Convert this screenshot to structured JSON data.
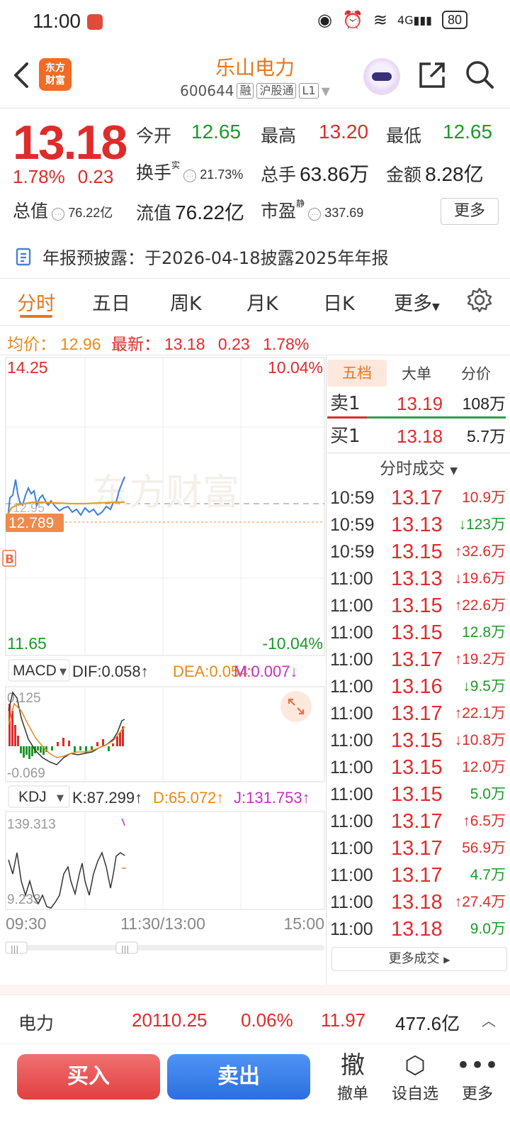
{
  "status_bar": {
    "time": "11:00",
    "battery": "80",
    "network": "4G"
  },
  "header": {
    "logo_line1": "东方",
    "logo_line2": "财富",
    "stock_name": "乐山电力",
    "stock_code": "600644",
    "tags": [
      "融",
      "沪股通",
      "L1"
    ]
  },
  "quote": {
    "price": "13.18",
    "change_pct": "1.78%",
    "change": "0.23",
    "open_label": "今开",
    "open": "12.65",
    "high_label": "最高",
    "high": "13.20",
    "low_label": "最低",
    "low": "12.65",
    "turnover_label": "换手",
    "turnover_sup": "实",
    "turnover": "21.73%",
    "volume_label": "总手",
    "volume": "63.86万",
    "amount_label": "金额",
    "amount": "8.28亿",
    "mktcap_label": "总值",
    "mktcap": "76.22亿",
    "float_label": "流值",
    "float_cap": "76.22亿",
    "pe_label": "市盈",
    "pe_sup": "静",
    "pe": "337.69",
    "more_label": "更多"
  },
  "notice": {
    "text": "年报预披露：于2026-04-18披露2025年年报"
  },
  "tabs": [
    "分时",
    "五日",
    "周K",
    "月K",
    "日K",
    "更多"
  ],
  "avg_line": {
    "avg_label": "均价：",
    "avg": "12.96",
    "latest_label": "最新：",
    "latest": "13.18",
    "change": "0.23",
    "pct": "1.78%"
  },
  "main_chart": {
    "y_top": "14.25",
    "y_bottom": "11.65",
    "pct_top": "10.04%",
    "pct_bottom": "-10.04%",
    "price_tag": "12.789",
    "faded_label": "12.95",
    "b_marker": "B",
    "watermark": "东方财富",
    "time_start": "09:30",
    "time_mid": "11:30/13:00",
    "time_end": "15:00"
  },
  "macd": {
    "label": "MACD",
    "dif": "DIF:0.058↑",
    "dea": "DEA:0.054↑",
    "m": "M:0.007↓",
    "top": "0.125",
    "bottom": "-0.069"
  },
  "kdj": {
    "label": "KDJ",
    "k": "K:87.299↑",
    "d": "D:65.072↑",
    "j": "J:131.753↑",
    "top": "139.313",
    "bottom": "9.233"
  },
  "side_tabs": [
    "五档",
    "大单",
    "分价"
  ],
  "order_book": [
    {
      "label": "卖1",
      "price": "13.19",
      "vol": "108万"
    },
    {
      "label": "买1",
      "price": "13.18",
      "vol": "5.7万"
    }
  ],
  "trades_title": "分时成交",
  "trades": [
    {
      "time": "10:59",
      "price": "13.17",
      "vol": "10.9万",
      "dir": "",
      "vc": "red"
    },
    {
      "time": "10:59",
      "price": "13.13",
      "vol": "↓123万",
      "dir": "down",
      "vc": "green"
    },
    {
      "time": "10:59",
      "price": "13.15",
      "vol": "↑32.6万",
      "dir": "up",
      "vc": "red"
    },
    {
      "time": "11:00",
      "price": "13.13",
      "vol": "↓19.6万",
      "dir": "down",
      "vc": "red"
    },
    {
      "time": "11:00",
      "price": "13.15",
      "vol": "↑22.6万",
      "dir": "up",
      "vc": "red"
    },
    {
      "time": "11:00",
      "price": "13.15",
      "vol": "12.8万",
      "dir": "",
      "vc": "green"
    },
    {
      "time": "11:00",
      "price": "13.17",
      "vol": "↑19.2万",
      "dir": "up",
      "vc": "red"
    },
    {
      "time": "11:00",
      "price": "13.16",
      "vol": "↓9.5万",
      "dir": "down",
      "vc": "green"
    },
    {
      "time": "11:00",
      "price": "13.17",
      "vol": "↑22.1万",
      "dir": "up",
      "vc": "red"
    },
    {
      "time": "11:00",
      "price": "13.15",
      "vol": "↓10.8万",
      "dir": "down",
      "vc": "red"
    },
    {
      "time": "11:00",
      "price": "13.15",
      "vol": "12.0万",
      "dir": "",
      "vc": "red"
    },
    {
      "time": "11:00",
      "price": "13.15",
      "vol": "5.0万",
      "dir": "",
      "vc": "green"
    },
    {
      "time": "11:00",
      "price": "13.17",
      "vol": "↑6.5万",
      "dir": "up",
      "vc": "red"
    },
    {
      "time": "11:00",
      "price": "13.17",
      "vol": "56.9万",
      "dir": "",
      "vc": "red"
    },
    {
      "time": "11:00",
      "price": "13.17",
      "vol": "4.7万",
      "dir": "",
      "vc": "green"
    },
    {
      "time": "11:00",
      "price": "13.18",
      "vol": "↑27.4万",
      "dir": "up",
      "vc": "red"
    },
    {
      "time": "11:00",
      "price": "13.18",
      "vol": "9.0万",
      "dir": "",
      "vc": "green"
    }
  ],
  "more_trades": "更多成交",
  "sector": {
    "name": "电力",
    "index": "20110.25",
    "pct": "0.06%",
    "val": "11.97",
    "amount": "477.6亿"
  },
  "actions": {
    "buy": "买入",
    "sell": "卖出",
    "cancel_icon": "撤",
    "cancel": "撤单",
    "watch": "设自选",
    "more": "更多"
  }
}
